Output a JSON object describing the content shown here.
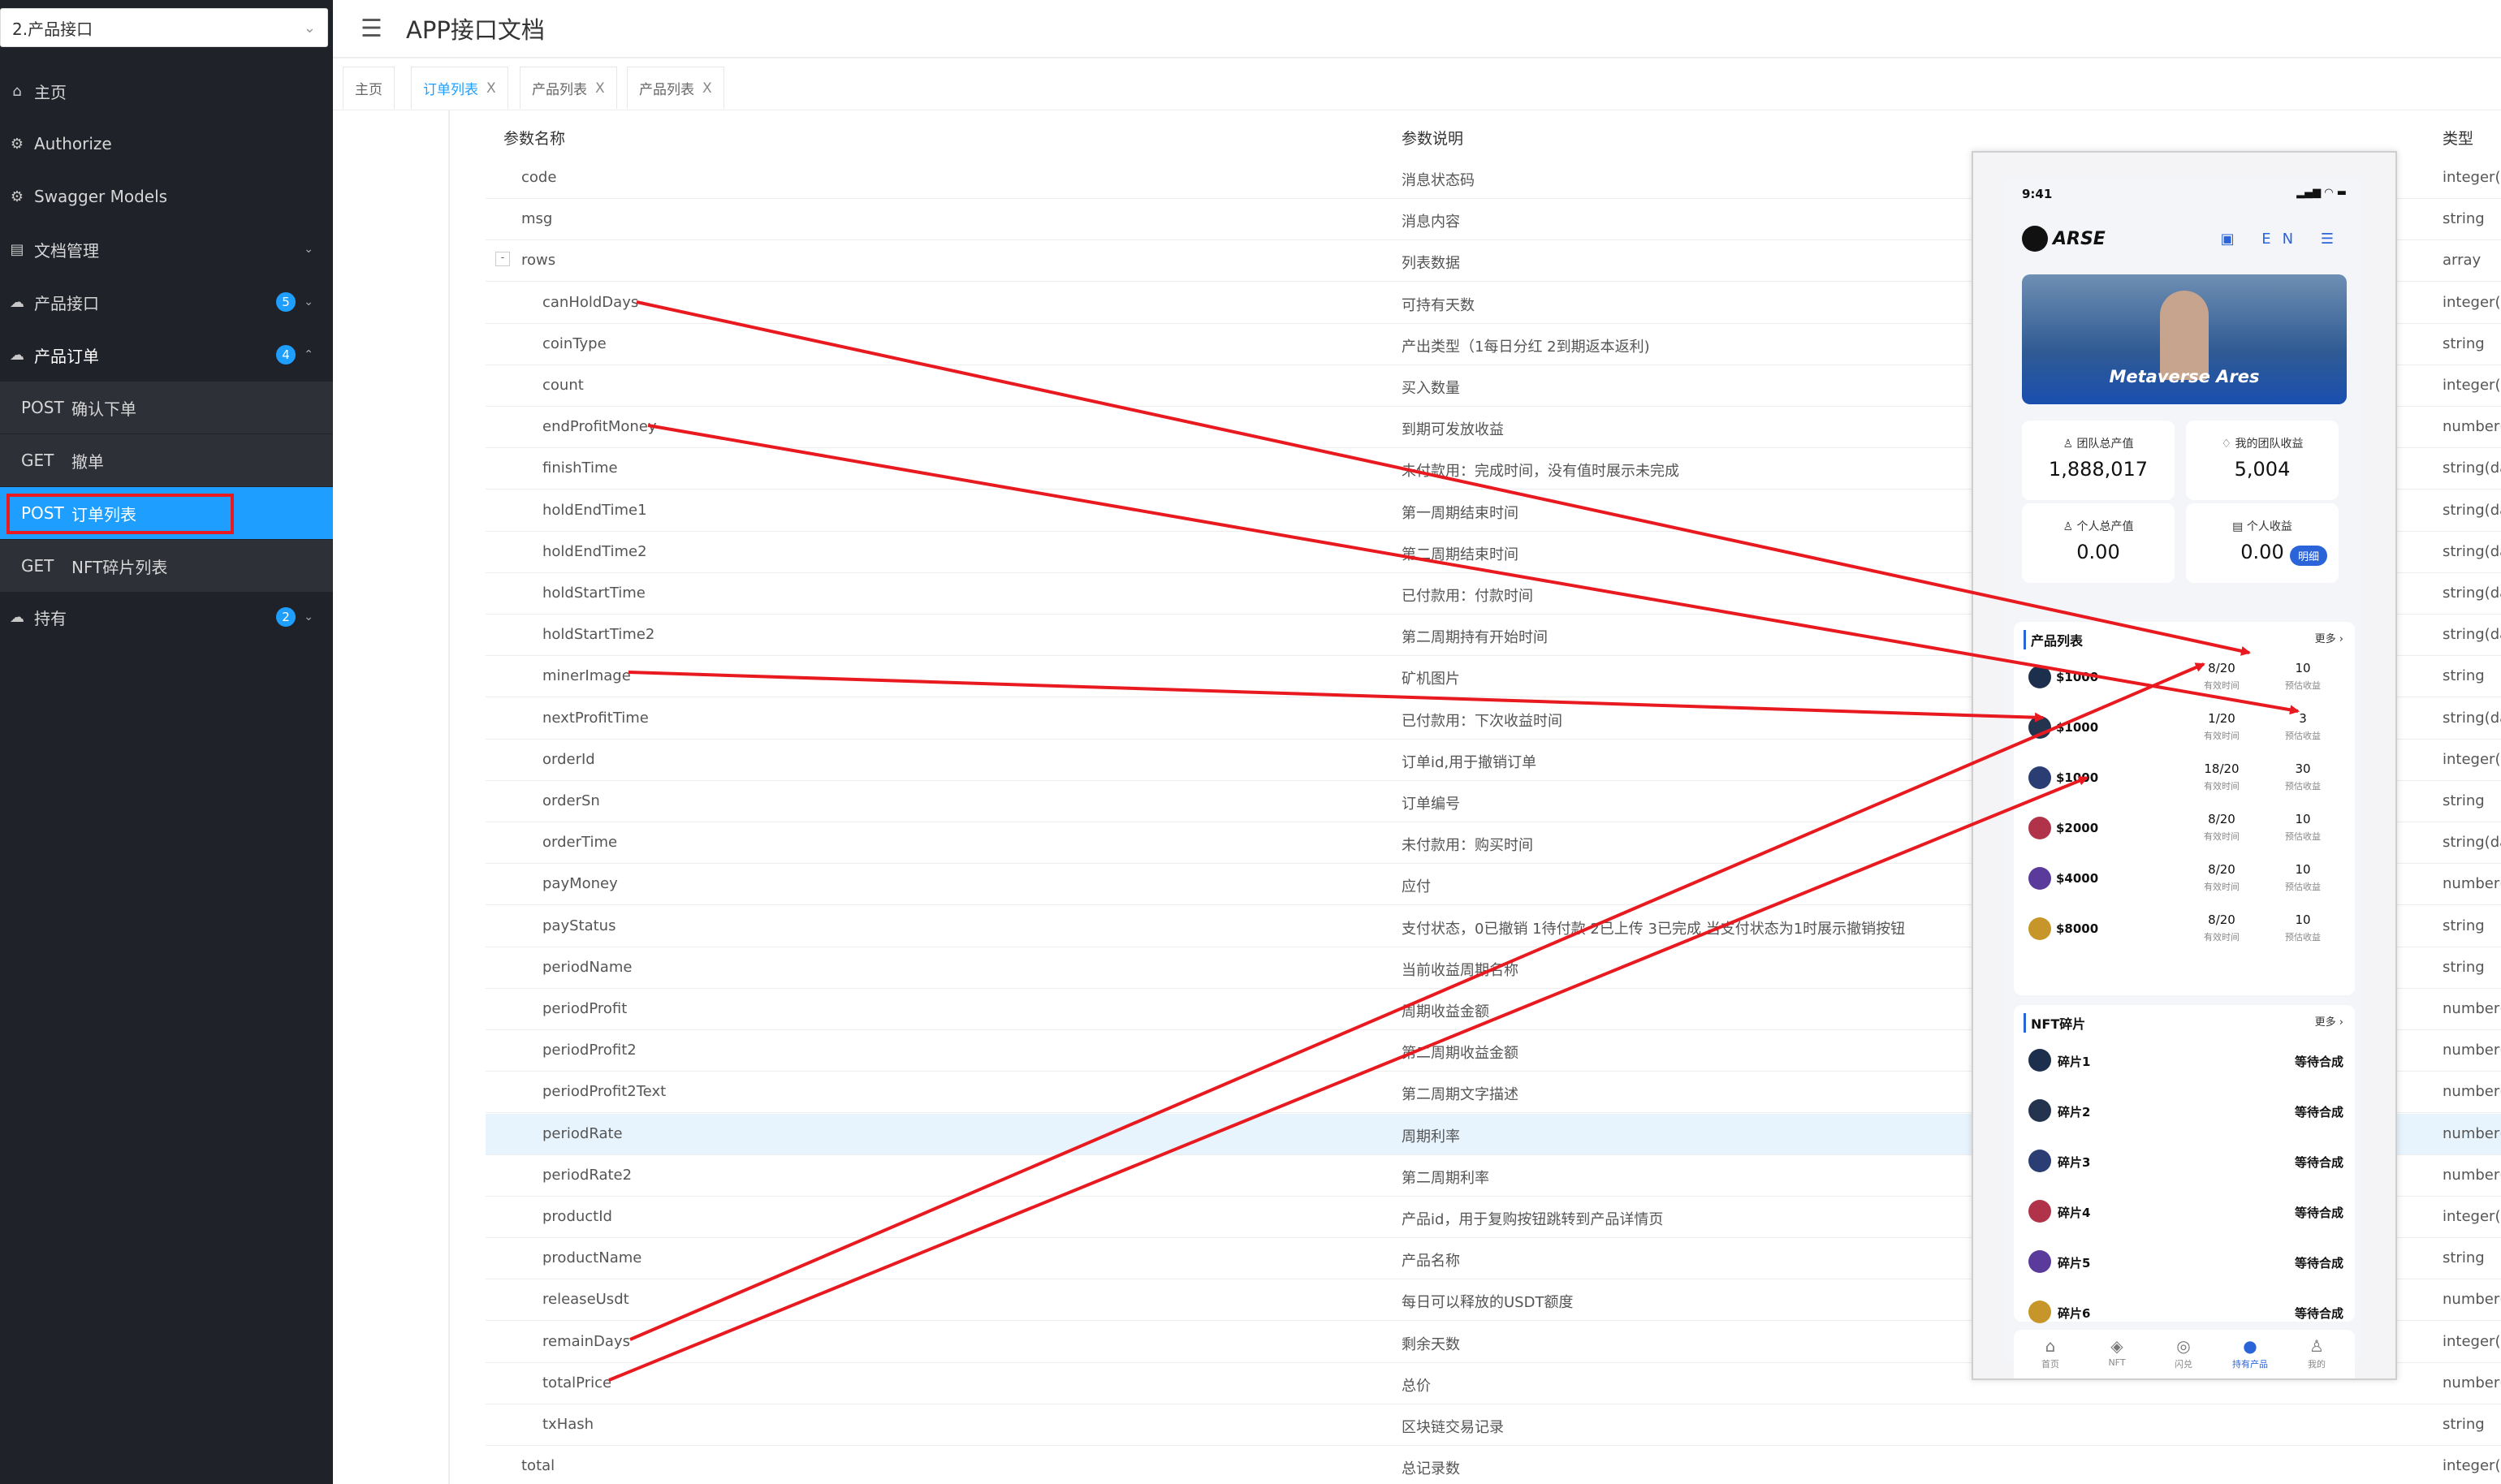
{
  "sidebar": {
    "group_select": "2.产品接口",
    "chevron": "⌄",
    "items": [
      {
        "icon": "⌂",
        "label": "主页"
      },
      {
        "icon": "⚙",
        "label": "Authorize"
      },
      {
        "icon": "⚙",
        "label": "Swagger Models"
      },
      {
        "icon": "▤",
        "label": "文档管理",
        "arrow": "⌄"
      },
      {
        "icon": "☁",
        "label": "产品接口",
        "badge": "5",
        "arrow": "⌄"
      },
      {
        "icon": "☁",
        "label": "产品订单",
        "badge": "4",
        "arrow": "⌃"
      },
      {
        "icon": "☁",
        "label": "持有",
        "badge": "2",
        "arrow": "⌄"
      }
    ],
    "sub_items": [
      {
        "method": "POST",
        "label": "确认下单"
      },
      {
        "method": "GET",
        "label": "撤单"
      },
      {
        "method": "POST",
        "label": "订单列表"
      },
      {
        "method": "GET",
        "label": "NFT碎片列表"
      }
    ]
  },
  "header": {
    "menu_icon": "☰",
    "title": "APP接口文档"
  },
  "tabs": [
    {
      "label": "主页"
    },
    {
      "label": "订单列表",
      "close": "X"
    },
    {
      "label": "产品列表",
      "close": "X"
    },
    {
      "label": "产品列表",
      "close": "X"
    }
  ],
  "table": {
    "headers": [
      "参数名称",
      "参数说明",
      "类型"
    ],
    "collapse_symbol": "-",
    "rows": [
      {
        "name": "code",
        "desc": "消息状态码",
        "type": "integer(in"
      },
      {
        "name": "msg",
        "desc": "消息内容",
        "type": "string"
      },
      {
        "name": "rows",
        "desc": "列表数据",
        "type": "array"
      },
      {
        "name": "canHoldDays",
        "desc": "可持有天数",
        "type": "integer(in"
      },
      {
        "name": "coinType",
        "desc": "产出类型（1每日分红 2到期返本返利)",
        "type": "string"
      },
      {
        "name": "count",
        "desc": "买入数量",
        "type": "integer(in"
      },
      {
        "name": "endProfitMoney",
        "desc": "到期可发放收益",
        "type": "number(b"
      },
      {
        "name": "finishTime",
        "desc": "未付款用：完成时间，没有值时展示未完成",
        "type": "string(da"
      },
      {
        "name": "holdEndTime1",
        "desc": "第一周期结束时间",
        "type": "string(da"
      },
      {
        "name": "holdEndTime2",
        "desc": "第二周期结束时间",
        "type": "string(da"
      },
      {
        "name": "holdStartTime",
        "desc": "已付款用：付款时间",
        "type": "string(da"
      },
      {
        "name": "holdStartTime2",
        "desc": "第二周期持有开始时间",
        "type": "string(da"
      },
      {
        "name": "minerImage",
        "desc": "矿机图片",
        "type": "string"
      },
      {
        "name": "nextProfitTime",
        "desc": "已付款用：下次收益时间",
        "type": "string(da"
      },
      {
        "name": "orderId",
        "desc": "订单id,用于撤销订单",
        "type": "integer(in"
      },
      {
        "name": "orderSn",
        "desc": "订单编号",
        "type": "string"
      },
      {
        "name": "orderTime",
        "desc": "未付款用：购买时间",
        "type": "string(da"
      },
      {
        "name": "payMoney",
        "desc": "应付",
        "type": "number(b"
      },
      {
        "name": "payStatus",
        "desc": "支付状态，0已撤销 1待付款 2已上传 3已完成 当支付状态为1时展示撤销按钮",
        "type": "string"
      },
      {
        "name": "periodName",
        "desc": "当前收益周期名称",
        "type": "string"
      },
      {
        "name": "periodProfit",
        "desc": "周期收益金额",
        "type": "number(b"
      },
      {
        "name": "periodProfit2",
        "desc": "第二周期收益金额",
        "type": "number(b"
      },
      {
        "name": "periodProfit2Text",
        "desc": "第二周期文字描述",
        "type": "number(b"
      },
      {
        "name": "periodRate",
        "desc": "周期利率",
        "type": "number(b"
      },
      {
        "name": "periodRate2",
        "desc": "第二周期利率",
        "type": "number(b"
      },
      {
        "name": "productId",
        "desc": "产品id，用于复购按钮跳转到产品详情页",
        "type": "integer(in"
      },
      {
        "name": "productName",
        "desc": "产品名称",
        "type": "string"
      },
      {
        "name": "releaseUsdt",
        "desc": "每日可以释放的USDT额度",
        "type": "number(b"
      },
      {
        "name": "remainDays",
        "desc": "剩余天数",
        "type": "integer(in"
      },
      {
        "name": "totalPrice",
        "desc": "总价",
        "type": "number(b"
      },
      {
        "name": "txHash",
        "desc": "区块链交易记录",
        "type": "string"
      },
      {
        "name": "total",
        "desc": "总记录数",
        "type": "integer(in"
      }
    ]
  },
  "phone": {
    "status_time": "9:41",
    "status_icons": "▂▄▆ ◠ ▬",
    "logo": "ARSE",
    "top_icons": "▣ EN ☰",
    "banner_text": "Metaverse Ares",
    "stats": [
      {
        "icon": "♙",
        "label": "团队总产值",
        "value": "1,888,017"
      },
      {
        "icon": "♢",
        "label": "我的团队收益",
        "value": "5,004"
      },
      {
        "icon": "♙",
        "label": "个人总产值",
        "value": "0.00"
      },
      {
        "icon": "▤",
        "label": "个人收益",
        "value": "0.00",
        "pill": "明细"
      }
    ],
    "products_title": "产品列表",
    "more": "更多 ›",
    "label_valid": "有效时间",
    "label_expected": "预估收益",
    "products": [
      {
        "price": "$1000",
        "time": "8/20",
        "profit": "10",
        "color": "#1c2f4d"
      },
      {
        "price": "$1000",
        "time": "1/20",
        "profit": "3",
        "color": "#24344f"
      },
      {
        "price": "$1000",
        "time": "18/20",
        "profit": "30",
        "color": "#2a3e74"
      },
      {
        "price": "$2000",
        "time": "8/20",
        "profit": "10",
        "color": "#b0334a"
      },
      {
        "price": "$4000",
        "time": "8/20",
        "profit": "10",
        "color": "#5a3a9a"
      },
      {
        "price": "$8000",
        "time": "8/20",
        "profit": "10",
        "color": "#c6962a"
      }
    ],
    "nft_title": "NFT碎片",
    "nft_status": "等待合成",
    "nfts": [
      {
        "name": "碎片1",
        "color": "#1c2f4d"
      },
      {
        "name": "碎片2",
        "color": "#24344f"
      },
      {
        "name": "碎片3",
        "color": "#2a3e74"
      },
      {
        "name": "碎片4",
        "color": "#b0334a"
      },
      {
        "name": "碎片5",
        "color": "#5a3a9a"
      },
      {
        "name": "碎片6",
        "color": "#c6962a"
      }
    ],
    "tabbar": [
      {
        "icon": "⌂",
        "label": "首页"
      },
      {
        "icon": "◈",
        "label": "NFT"
      },
      {
        "icon": "◎",
        "label": "闪兑"
      },
      {
        "icon": "●",
        "label": "持有产品",
        "active": true
      },
      {
        "icon": "♙",
        "label": "我的"
      }
    ]
  },
  "colors": {
    "accent": "#1e9fff",
    "sidebar_bg": "#20222a",
    "annotation": "#e8191f",
    "phone_brand": "#2b64d8"
  }
}
